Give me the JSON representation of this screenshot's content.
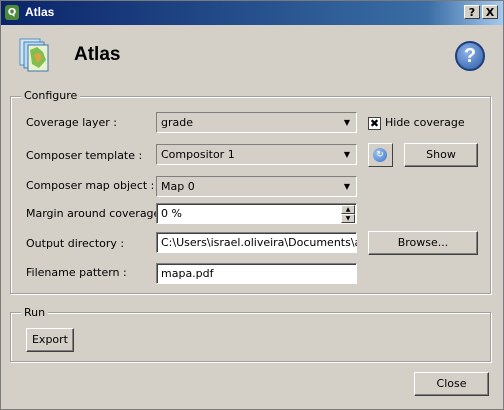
{
  "window": {
    "title": "Atlas",
    "help_btn": "?",
    "close_btn": "X"
  },
  "header": {
    "title": "Atlas",
    "help_glyph": "?"
  },
  "configure": {
    "group_title": "Configure",
    "coverage_layer": {
      "label": "Coverage layer :",
      "value": "grade"
    },
    "hide_coverage": {
      "label": "Hide coverage",
      "checked": true,
      "mark": "✖"
    },
    "composer_template": {
      "label": "Composer template :",
      "value": "Compositor 1"
    },
    "refresh_glyph": "↻",
    "show_button": "Show",
    "composer_map_object": {
      "label": "Composer map object :",
      "value": "Map 0"
    },
    "margin": {
      "label": "Margin around coverage :",
      "value": "0 %"
    },
    "output_directory": {
      "label": "Output directory :",
      "value": "C:\\Users\\israel.oliveira\\Documents\\atlas"
    },
    "browse_button": "Browse...",
    "filename_pattern": {
      "label": "Filename pattern :",
      "value": "mapa.pdf"
    }
  },
  "run": {
    "group_title": "Run",
    "export_button": "Export"
  },
  "footer": {
    "close_button": "Close"
  },
  "icons": {
    "window": "qgis-icon",
    "header": "atlas-map-icon",
    "help": "help-icon",
    "refresh": "refresh-icon",
    "dropdown": "chevron-down-icon"
  }
}
